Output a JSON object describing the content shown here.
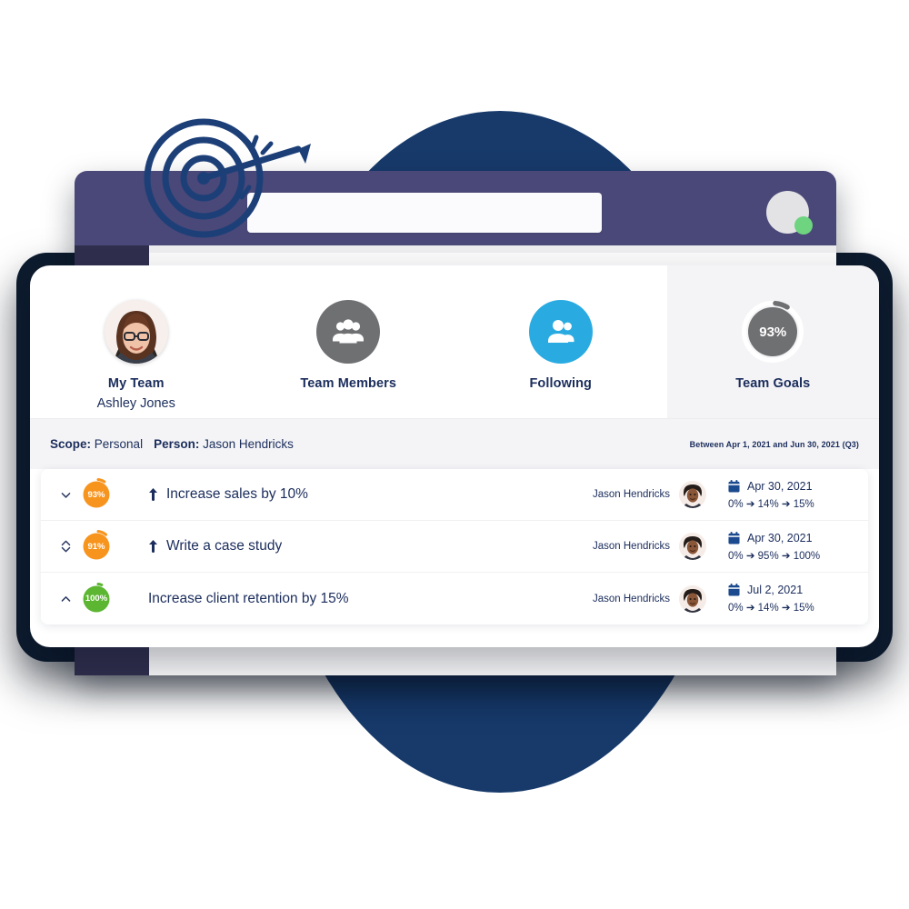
{
  "colors": {
    "header_purple": "#4a4878",
    "bg_navy_circle": "#173a6b",
    "bg_plate": "#0d1b2e",
    "text_navy": "#1b2d5c",
    "accent_blue": "#29abe2",
    "gray_circle": "#6f7072",
    "orange": "#f7941e",
    "green": "#5cb632",
    "status_dot_green": "#6ed47f",
    "selected_panel": "#f4f4f6"
  },
  "browser_window": {
    "search_value": "",
    "search_placeholder": "",
    "avatar_status": "online"
  },
  "logo": {
    "name": "target-bullseye-arrow-logo"
  },
  "nav_cards": [
    {
      "id": "my-team",
      "title": "My Team",
      "subtitle": "Ashley Jones",
      "icon": "user-photo-avatar",
      "selected": false
    },
    {
      "id": "team-members",
      "title": "Team Members",
      "subtitle": "",
      "icon": "users-group-icon",
      "selected": false
    },
    {
      "id": "following",
      "title": "Following",
      "subtitle": "",
      "icon": "user-follow-icon",
      "selected": false
    },
    {
      "id": "team-goals",
      "title": "Team Goals",
      "subtitle": "",
      "icon": "progress-ring-icon",
      "value": "93%",
      "percent": 93,
      "selected": true
    }
  ],
  "filter_bar": {
    "scope_label": "Scope:",
    "scope_value": "Personal",
    "person_label": "Person:",
    "person_value": "Jason Hendricks",
    "date_range": "Between Apr 1, 2021 and Jun 30, 2021 (Q3)"
  },
  "goals": [
    {
      "toggle_icon": "chevron-down-icon",
      "percent": 93,
      "percent_label": "93%",
      "ring_color": "#f7941e",
      "priority_icon": "priority-up-arrow-icon",
      "has_priority": true,
      "title": "Increase sales by 10%",
      "owner": "Jason Hendricks",
      "date": "Apr 30, 2021",
      "progress": "0% ➔ 14% ➔ 15%",
      "progress_start": "0%",
      "progress_current": "14%",
      "progress_target": "15%"
    },
    {
      "toggle_icon": "chevron-up-down-icon",
      "percent": 91,
      "percent_label": "91%",
      "ring_color": "#f7941e",
      "priority_icon": "priority-up-arrow-icon",
      "has_priority": true,
      "title": "Write a case study",
      "owner": "Jason Hendricks",
      "date": "Apr 30, 2021",
      "progress": "0% ➔ 95% ➔ 100%",
      "progress_start": "0%",
      "progress_current": "95%",
      "progress_target": "100%"
    },
    {
      "toggle_icon": "chevron-up-icon",
      "percent": 100,
      "percent_label": "100%",
      "ring_color": "#5cb632",
      "priority_icon": "",
      "has_priority": false,
      "title": "Increase client retention by 15%",
      "owner": "Jason Hendricks",
      "date": "Jul 2, 2021",
      "progress": "0% ➔ 14% ➔ 15%",
      "progress_start": "0%",
      "progress_current": "14%",
      "progress_target": "15%"
    }
  ]
}
